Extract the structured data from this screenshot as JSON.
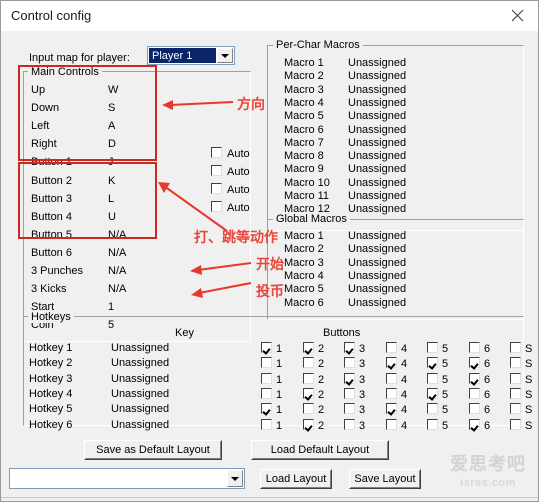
{
  "window": {
    "title": "Control config",
    "close_label": "×"
  },
  "input_map": {
    "label": "Input map for player:",
    "selected": "Player 1"
  },
  "main_controls": {
    "title": "Main Controls",
    "rows": [
      {
        "name": "Up",
        "key": "W"
      },
      {
        "name": "Down",
        "key": "S"
      },
      {
        "name": "Left",
        "key": "A"
      },
      {
        "name": "Right",
        "key": "D"
      },
      {
        "name": "Button 1",
        "key": "J"
      },
      {
        "name": "Button 2",
        "key": "K"
      },
      {
        "name": "Button 3",
        "key": "L"
      },
      {
        "name": "Button 4",
        "key": "U"
      },
      {
        "name": "Button 5",
        "key": "N/A"
      },
      {
        "name": "Button 6",
        "key": "N/A"
      },
      {
        "name": "3 Punches",
        "key": "N/A"
      },
      {
        "name": "3 Kicks",
        "key": "N/A"
      },
      {
        "name": "Start",
        "key": "1"
      },
      {
        "name": "Coin",
        "key": "5"
      }
    ]
  },
  "auto_checkboxes": [
    {
      "label": "Auto",
      "checked": false
    },
    {
      "label": "Auto",
      "checked": false
    },
    {
      "label": "Auto",
      "checked": false
    },
    {
      "label": "Auto",
      "checked": false
    }
  ],
  "per_char_macros": {
    "title": "Per-Char Macros",
    "rows": [
      {
        "name": "Macro 1",
        "value": "Unassigned"
      },
      {
        "name": "Macro 2",
        "value": "Unassigned"
      },
      {
        "name": "Macro 3",
        "value": "Unassigned"
      },
      {
        "name": "Macro 4",
        "value": "Unassigned"
      },
      {
        "name": "Macro 5",
        "value": "Unassigned"
      },
      {
        "name": "Macro 6",
        "value": "Unassigned"
      },
      {
        "name": "Macro 7",
        "value": "Unassigned"
      },
      {
        "name": "Macro 8",
        "value": "Unassigned"
      },
      {
        "name": "Macro 9",
        "value": "Unassigned"
      },
      {
        "name": "Macro 10",
        "value": "Unassigned"
      },
      {
        "name": "Macro 11",
        "value": "Unassigned"
      },
      {
        "name": "Macro 12",
        "value": "Unassigned"
      }
    ]
  },
  "global_macros": {
    "title": "Global Macros",
    "rows": [
      {
        "name": "Macro 1",
        "value": "Unassigned"
      },
      {
        "name": "Macro 2",
        "value": "Unassigned"
      },
      {
        "name": "Macro 3",
        "value": "Unassigned"
      },
      {
        "name": "Macro 4",
        "value": "Unassigned"
      },
      {
        "name": "Macro 5",
        "value": "Unassigned"
      },
      {
        "name": "Macro 6",
        "value": "Unassigned"
      }
    ]
  },
  "hotkeys": {
    "title": "Hotkeys",
    "col_key": "Key",
    "col_buttons": "Buttons",
    "button_labels": [
      "1",
      "2",
      "3",
      "4",
      "5",
      "6",
      "S"
    ],
    "rows": [
      {
        "name": "Hotkey 1",
        "key": "Unassigned",
        "checks": [
          true,
          true,
          true,
          false,
          false,
          false,
          false
        ]
      },
      {
        "name": "Hotkey 2",
        "key": "Unassigned",
        "checks": [
          false,
          false,
          false,
          true,
          true,
          true,
          false
        ]
      },
      {
        "name": "Hotkey 3",
        "key": "Unassigned",
        "checks": [
          false,
          false,
          true,
          false,
          false,
          true,
          false
        ]
      },
      {
        "name": "Hotkey 4",
        "key": "Unassigned",
        "checks": [
          false,
          true,
          false,
          false,
          true,
          false,
          false
        ]
      },
      {
        "name": "Hotkey 5",
        "key": "Unassigned",
        "checks": [
          true,
          false,
          false,
          true,
          false,
          false,
          false
        ]
      },
      {
        "name": "Hotkey 6",
        "key": "Unassigned",
        "checks": [
          false,
          true,
          false,
          false,
          false,
          true,
          false
        ]
      }
    ]
  },
  "footer": {
    "save_default_layout": "Save as  Default Layout",
    "load_default_layout": "Load Default Layout",
    "load_layout": "Load Layout",
    "save_layout": "Save Layout",
    "layout_combo_value": ""
  },
  "annotations": {
    "direction": "方向",
    "actions": "打、跳等动作",
    "start": "开始",
    "coin": "投币",
    "color": "#e8382b"
  },
  "watermark": {
    "line1": "爱思考吧",
    "line2": "isres.com"
  }
}
